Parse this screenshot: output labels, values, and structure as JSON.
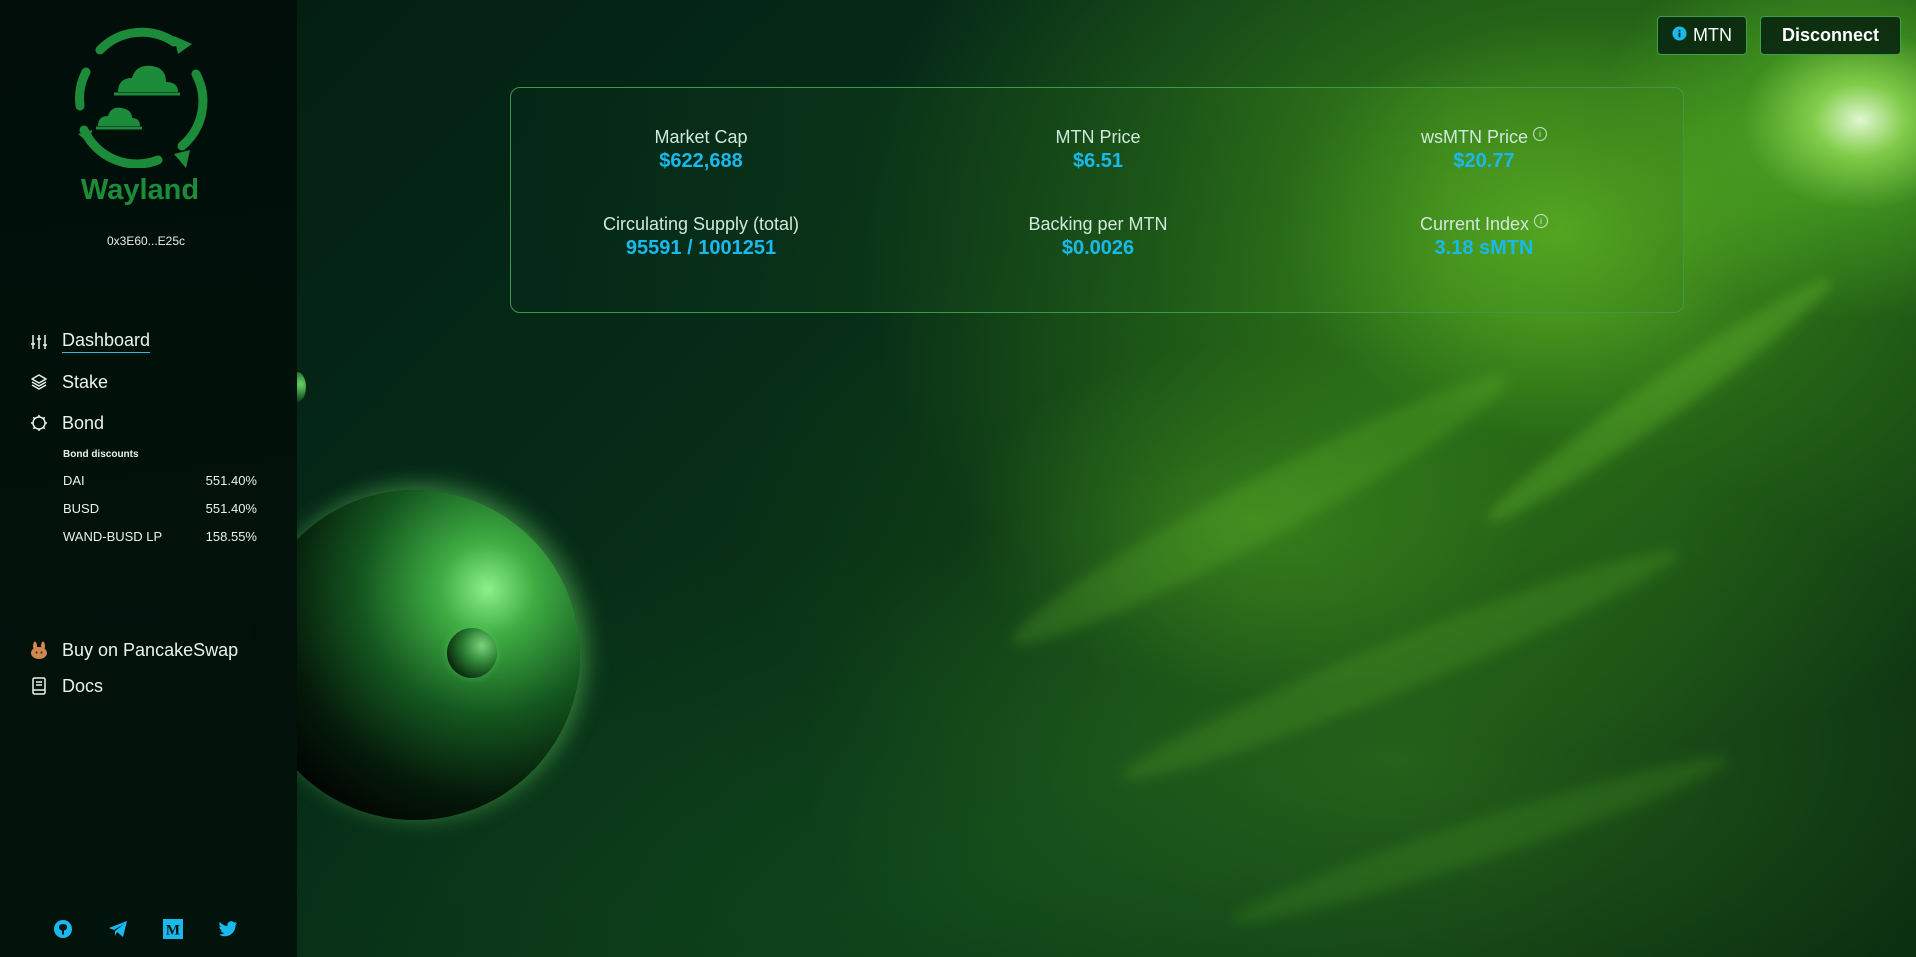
{
  "brand": {
    "name": "Wayland",
    "wallet": "0x3E60...E25c"
  },
  "nav": [
    {
      "label": "Dashboard",
      "icon": "sliders-icon",
      "active": true
    },
    {
      "label": "Stake",
      "icon": "layers-icon"
    },
    {
      "label": "Bond",
      "icon": "bond-icon"
    }
  ],
  "bond_discounts": {
    "title": "Bond discounts",
    "items": [
      {
        "name": "DAI",
        "discount": "551.40%"
      },
      {
        "name": "BUSD",
        "discount": "551.40%"
      },
      {
        "name": "WAND-BUSD LP",
        "discount": "158.55%"
      }
    ]
  },
  "external_links": [
    {
      "label": "Buy on PancakeSwap",
      "icon": "pancakeswap-icon"
    },
    {
      "label": "Docs",
      "icon": "docs-icon"
    }
  ],
  "socials": [
    "github-icon",
    "telegram-icon",
    "medium-icon",
    "twitter-icon"
  ],
  "header": {
    "token_label": "MTN",
    "disconnect_label": "Disconnect"
  },
  "stats": {
    "market_cap": {
      "label": "Market Cap",
      "value": "$622,688"
    },
    "mtn_price": {
      "label": "MTN Price",
      "value": "$6.51"
    },
    "wsmtn_price": {
      "label": "wsMTN Price",
      "value": "$20.77"
    },
    "circulating_supply": {
      "label": "Circulating Supply (total)",
      "value": "95591 / 1001251"
    },
    "backing": {
      "label": "Backing per MTN",
      "value": "$0.0026"
    },
    "current_index": {
      "label": "Current Index",
      "value": "3.18 sMTN"
    }
  },
  "colors": {
    "accent": "#19b9ee",
    "brand_green": "#1c8c3a",
    "border_green": "#3c9a46"
  }
}
